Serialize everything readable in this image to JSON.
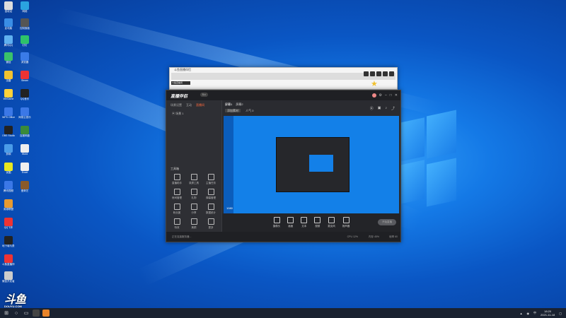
{
  "desktop": {
    "icon_labels": [
      "回收站",
      "网络",
      "此电脑",
      "控制面板",
      "腾讯QQ",
      "微信",
      "钉钉",
      "浏览器",
      "迅雷",
      "Steam",
      "WeGame",
      "QQ音乐",
      "网易云音乐",
      "百度网盘",
      "WPS Office",
      "Word",
      "Excel",
      "PowerPoint",
      "OBS Studio",
      "斗鱼直播伴侣",
      "剪映",
      "Photoshop",
      "优酷",
      "腾讯视频",
      "爱奇艺",
      "英雄联盟",
      "QQ飞车",
      "地下城与勇士",
      "微信开发者工具"
    ]
  },
  "small_window": {
    "title": "斗鱼直播伴侣",
    "field_value": "斗鱼直播间"
  },
  "main_window": {
    "logo": "直播伴侣",
    "version_badge": "5.x",
    "sidebar": {
      "tabs": [
        "场景设置",
        "互动",
        "直播间"
      ],
      "active_tab": "直播间",
      "scene_label": "场景 1",
      "tools_header": "工具箱",
      "tools": [
        "直播助手",
        "录屏工具",
        "主播任务",
        "房间管理",
        "礼物",
        "弹幕管理",
        "粉丝团",
        "分享",
        "数据统计",
        "特效",
        "美颜",
        "更多"
      ]
    },
    "content": {
      "scene_tabs": [
        "屏幕1",
        "屏幕2"
      ],
      "active_scene": "屏幕1",
      "sources_button": "添加素材",
      "viewers": "人气 0",
      "preview_overlay": "1080"
    },
    "bottom_tools": [
      "摄像头",
      "画面",
      "文本",
      "视频",
      "麦克风",
      "扬声器"
    ],
    "start_button": "开始直播",
    "status_text": "正在连接服务器...",
    "status_right": [
      "CPU 12%",
      "内存 45%",
      "帧率 60"
    ]
  },
  "watermark": {
    "brand": "斗鱼",
    "site": "DOUYU.COM"
  },
  "taskbar": {
    "time": "18:20",
    "date": "2021-11-18",
    "tray_label": "中"
  },
  "colors": {
    "accent": "#ff6a3d",
    "desktop_blue": "#1479e6",
    "window_dark": "#2a2b30"
  }
}
